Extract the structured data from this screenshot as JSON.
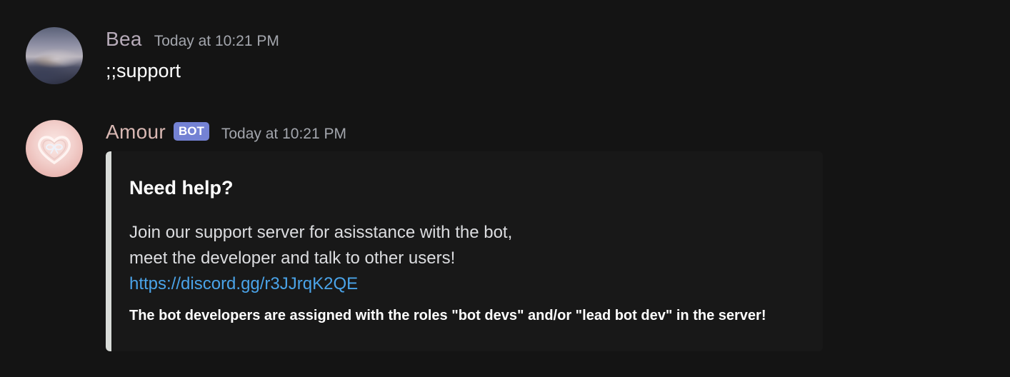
{
  "messages": [
    {
      "author": "Bea",
      "timestamp": "Today at 10:21 PM",
      "content": ";;support",
      "avatar_icon": "user-avatar-landscape",
      "name_color": "#b7abb9"
    },
    {
      "author": "Amour",
      "bot_tag": "BOT",
      "timestamp": "Today at 10:21 PM",
      "avatar_icon": "heart-bow-avatar",
      "name_color": "#d9b8b3",
      "embed": {
        "title": "Need help?",
        "description_line_1": "Join our support server for asisstance with the bot,",
        "description_line_2": "meet the developer and talk to other users!",
        "link": "https://discord.gg/r3JJrqK2QE",
        "footer": "The bot developers are assigned with the roles \"bot devs\" and/or \"lead bot dev\" in the server!",
        "bar_color": "#d9dcd9"
      }
    }
  ],
  "colors": {
    "background": "#141414",
    "embed_background": "#181818",
    "link": "#4aa3e8",
    "bot_tag": "#7482d4",
    "timestamp": "#a3a6ad"
  }
}
